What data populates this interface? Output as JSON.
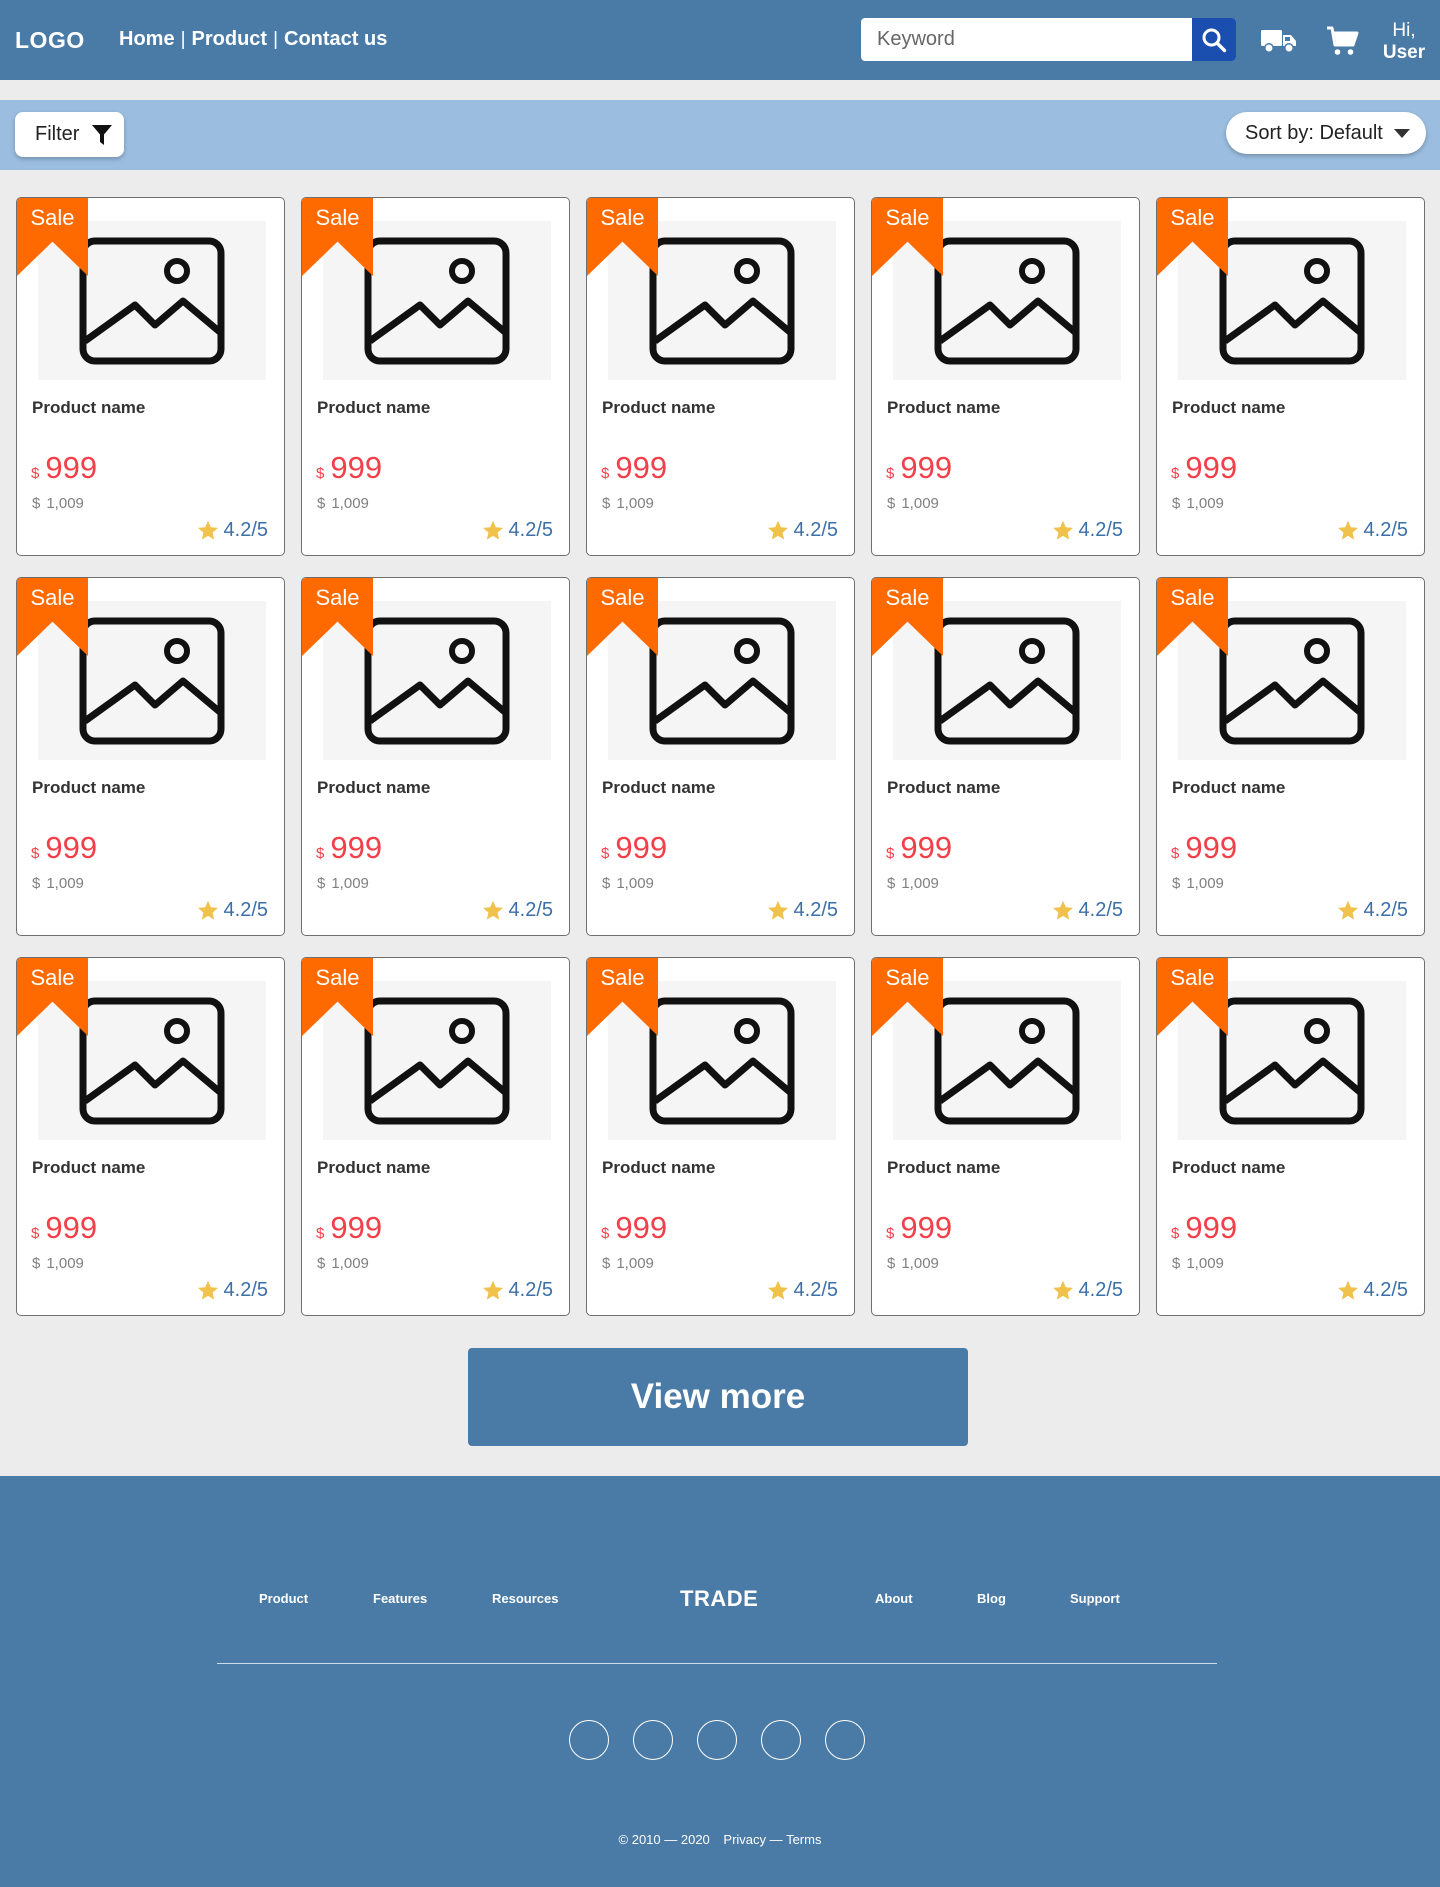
{
  "header": {
    "logo": "LOGO",
    "nav": [
      {
        "label": "Home"
      },
      {
        "label": "Product"
      },
      {
        "label": "Contact us"
      }
    ],
    "nav_separator": "|",
    "search": {
      "placeholder": "Keyword",
      "value": ""
    },
    "greeting_line1": "Hi,",
    "greeting_line2": "User",
    "icons": [
      "search-icon",
      "truck-icon",
      "cart-icon"
    ]
  },
  "toolbar": {
    "filter_label": "Filter",
    "sort_label": "Sort by: Default"
  },
  "products": [
    {
      "badge": "Sale",
      "name": "Product name",
      "currency": "$",
      "price": "999",
      "old_price": "1,009",
      "rating": "4.2/5"
    },
    {
      "badge": "Sale",
      "name": "Product name",
      "currency": "$",
      "price": "999",
      "old_price": "1,009",
      "rating": "4.2/5"
    },
    {
      "badge": "Sale",
      "name": "Product name",
      "currency": "$",
      "price": "999",
      "old_price": "1,009",
      "rating": "4.2/5"
    },
    {
      "badge": "Sale",
      "name": "Product name",
      "currency": "$",
      "price": "999",
      "old_price": "1,009",
      "rating": "4.2/5"
    },
    {
      "badge": "Sale",
      "name": "Product name",
      "currency": "$",
      "price": "999",
      "old_price": "1,009",
      "rating": "4.2/5"
    },
    {
      "badge": "Sale",
      "name": "Product name",
      "currency": "$",
      "price": "999",
      "old_price": "1,009",
      "rating": "4.2/5"
    },
    {
      "badge": "Sale",
      "name": "Product name",
      "currency": "$",
      "price": "999",
      "old_price": "1,009",
      "rating": "4.2/5"
    },
    {
      "badge": "Sale",
      "name": "Product name",
      "currency": "$",
      "price": "999",
      "old_price": "1,009",
      "rating": "4.2/5"
    },
    {
      "badge": "Sale",
      "name": "Product name",
      "currency": "$",
      "price": "999",
      "old_price": "1,009",
      "rating": "4.2/5"
    },
    {
      "badge": "Sale",
      "name": "Product name",
      "currency": "$",
      "price": "999",
      "old_price": "1,009",
      "rating": "4.2/5"
    },
    {
      "badge": "Sale",
      "name": "Product name",
      "currency": "$",
      "price": "999",
      "old_price": "1,009",
      "rating": "4.2/5"
    },
    {
      "badge": "Sale",
      "name": "Product name",
      "currency": "$",
      "price": "999",
      "old_price": "1,009",
      "rating": "4.2/5"
    },
    {
      "badge": "Sale",
      "name": "Product name",
      "currency": "$",
      "price": "999",
      "old_price": "1,009",
      "rating": "4.2/5"
    },
    {
      "badge": "Sale",
      "name": "Product name",
      "currency": "$",
      "price": "999",
      "old_price": "1,009",
      "rating": "4.2/5"
    },
    {
      "badge": "Sale",
      "name": "Product name",
      "currency": "$",
      "price": "999",
      "old_price": "1,009",
      "rating": "4.2/5"
    }
  ],
  "view_more_label": "View more",
  "footer": {
    "links_left": [
      "Product",
      "Features",
      "Resources"
    ],
    "brand": "TRADE",
    "links_right": [
      "About",
      "Blog",
      "Support"
    ],
    "social_count": 5,
    "copyright": "© 2010 — 2020",
    "privacy": "Privacy",
    "legal_sep": "—",
    "terms": "Terms"
  },
  "colors": {
    "header_bg": "#4a7ba7",
    "toolbar_bg": "#9bbde0",
    "page_bg": "#ececec",
    "sale_badge": "#ff6a00",
    "price": "#f2404a",
    "rating_text": "#3b6fa8",
    "star": "#f0c24b",
    "search_button": "#1a4fb0"
  }
}
